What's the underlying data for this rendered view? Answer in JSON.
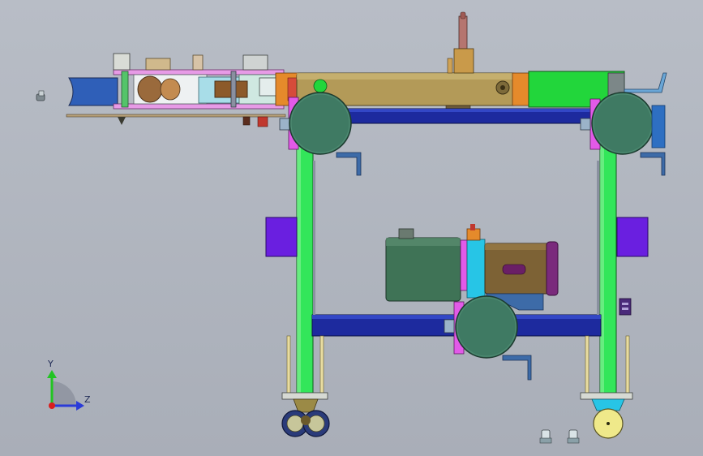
{
  "viewport": {
    "background_top": "#b8bdc6",
    "background_bottom": "#a9aeb8"
  },
  "triad": {
    "y_label": "Y",
    "z_label": "Z",
    "y_color": "#22c422",
    "z_color": "#2a3bd8",
    "origin_color": "#d81e1e"
  },
  "colors": {
    "frame_green": "#33e65a",
    "frame_blue": "#1d2a9e",
    "wheel_green": "#3f7a63",
    "pink": "#e25ae8",
    "purple_block": "#6a1fe0",
    "tan_cylinder": "#b39a58",
    "motor_green": "#3f7356",
    "motor_brown": "#7d6235",
    "bright_green": "#22d63b",
    "cyan": "#27c5e6",
    "orange": "#e58a2b"
  }
}
